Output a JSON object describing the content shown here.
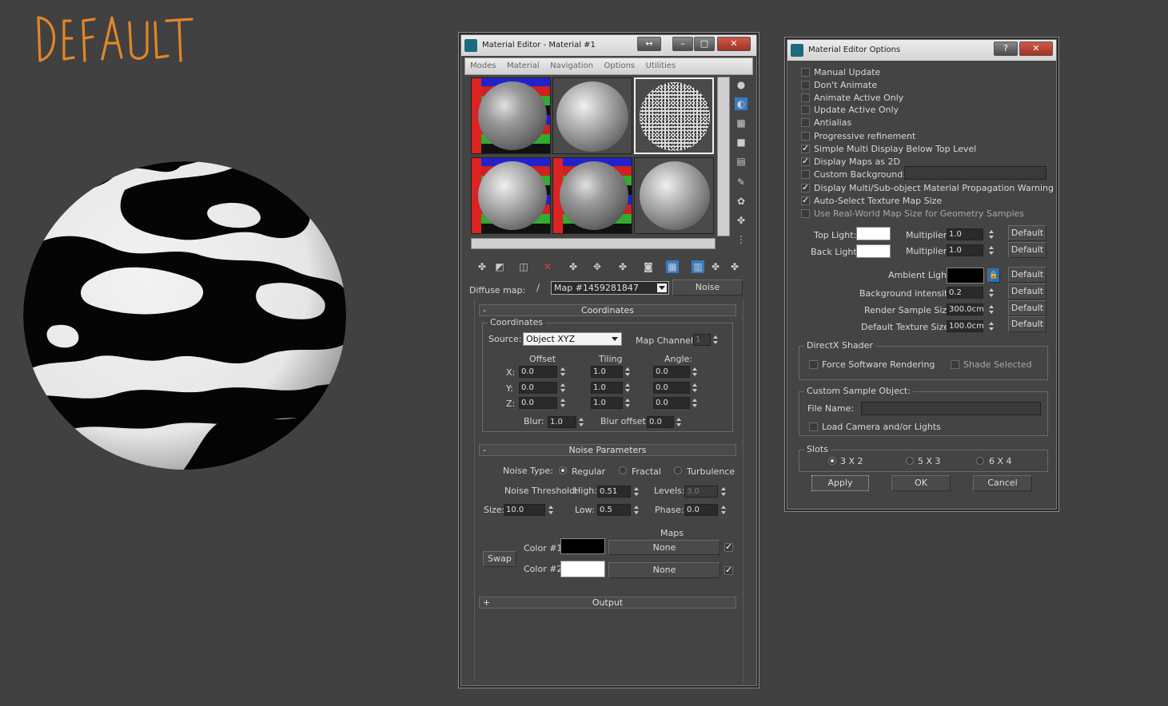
{
  "label_default": "DEFAULT",
  "mat_editor": {
    "title": "Material Editor - Material #1",
    "menu": [
      "Modes",
      "Material",
      "Navigation",
      "Options",
      "Utilities"
    ],
    "diffuse_label": "Diffuse map:",
    "map_name": "Map #1459281847",
    "map_type": "Noise",
    "coordinates": {
      "rollout": "Coordinates",
      "group": "Coordinates",
      "source_label": "Source:",
      "source_value": "Object XYZ",
      "map_channel_label": "Map Channel:",
      "map_channel_value": "1",
      "offset_label": "Offset",
      "tiling_label": "Tiling",
      "angle_label": "Angle:",
      "x_label": "X:",
      "y_label": "Y:",
      "z_label": "Z:",
      "offset": [
        "0.0",
        "0.0",
        "0.0"
      ],
      "tiling": [
        "1.0",
        "1.0",
        "1.0"
      ],
      "angle": [
        "0.0",
        "0.0",
        "0.0"
      ],
      "blur_label": "Blur:",
      "blur_value": "1.0",
      "blur_offset_label": "Blur offset:",
      "blur_offset_value": "0.0"
    },
    "noise": {
      "rollout": "Noise Parameters",
      "type_label": "Noise Type:",
      "types": [
        "Regular",
        "Fractal",
        "Turbulence"
      ],
      "threshold_label": "Noise Threshold:",
      "high_label": "High:",
      "high_value": "0.51",
      "levels_label": "Levels:",
      "levels_value": "3.0",
      "size_label": "Size:",
      "size_value": "10.0",
      "low_label": "Low:",
      "low_value": "0.5",
      "phase_label": "Phase:",
      "phase_value": "0.0",
      "maps_label": "Maps",
      "color1_label": "Color #1",
      "color2_label": "Color #2",
      "swap_label": "Swap",
      "map1": "None",
      "map2": "None"
    },
    "output_rollout": "Output"
  },
  "options": {
    "title": "Material Editor Options",
    "help": "?",
    "checks": [
      {
        "label": "Manual Update",
        "on": false
      },
      {
        "label": "Don't Animate",
        "on": false
      },
      {
        "label": "Animate Active Only",
        "on": false
      },
      {
        "label": "Update Active Only",
        "on": false
      },
      {
        "label": "Antialias",
        "on": false
      },
      {
        "label": "Progressive refinement",
        "on": false
      },
      {
        "label": "Simple Multi Display Below Top Level",
        "on": true
      },
      {
        "label": "Display Maps as 2D",
        "on": true
      },
      {
        "label": "Custom Background:",
        "on": false
      },
      {
        "label": "Display Multi/Sub-object Material Propagation Warning",
        "on": true
      },
      {
        "label": "Auto-Select Texture Map Size",
        "on": true
      },
      {
        "label": "Use Real-World Map Size for Geometry Samples",
        "on": false
      }
    ],
    "top_light_label": "Top Light:",
    "back_light_label": "Back Light:",
    "multiplier_label": "Multiplier:",
    "top_mult": "1.0",
    "back_mult": "1.0",
    "default_label": "Default",
    "ambient_label": "Ambient Light:",
    "bg_intensity_label": "Background intensity:",
    "bg_intensity": "0.2",
    "render_sample_label": "Render Sample Size:",
    "render_sample": "300.0cm",
    "default_tex_label": "Default Texture Size:",
    "default_tex": "100.0cm",
    "directx_group": "DirectX Shader",
    "force_sw": "Force Software Rendering",
    "shade_selected": "Shade Selected",
    "custom_sample_group": "Custom Sample Object:",
    "file_name_label": "File Name:",
    "load_camera": "Load Camera and/or Lights",
    "slots_group": "Slots",
    "slots": [
      "3 X 2",
      "5 X 3",
      "6 X 4"
    ],
    "apply": "Apply",
    "ok": "OK",
    "cancel": "Cancel"
  }
}
